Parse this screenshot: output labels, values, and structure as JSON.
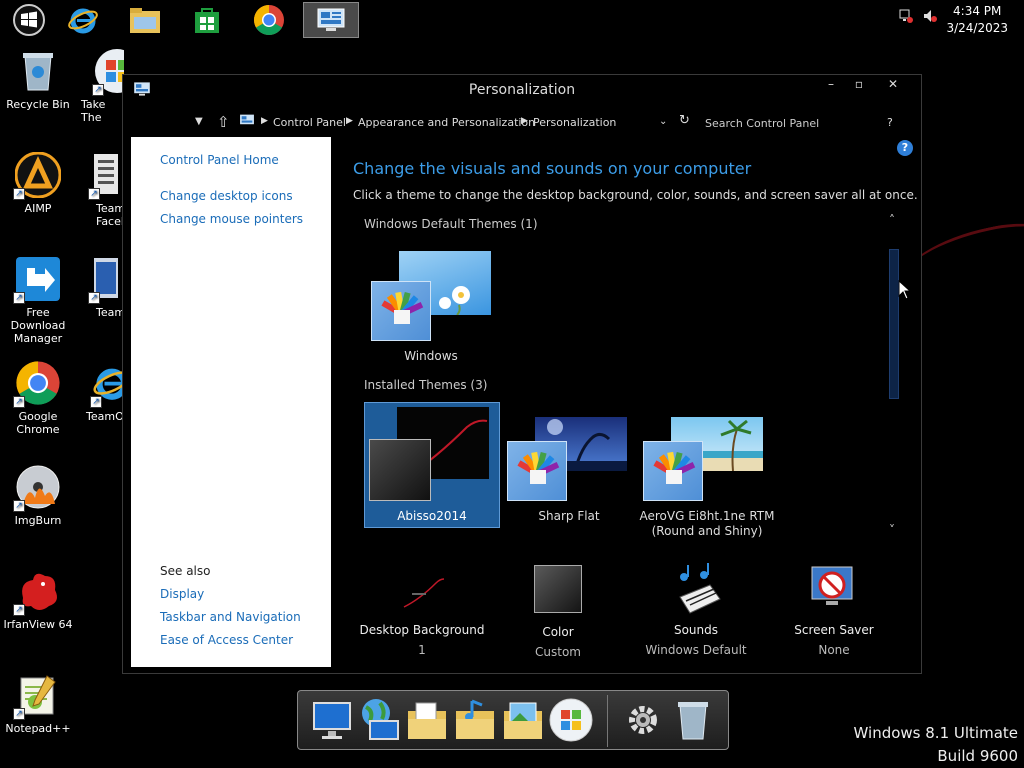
{
  "taskbar": {
    "clock_time": "4:34 PM",
    "clock_date": "3/24/2023"
  },
  "desktop_icons": [
    {
      "label": "Recycle Bin"
    },
    {
      "label": "Take The"
    },
    {
      "label": "AIMP"
    },
    {
      "label": "Team",
      "label2": "Faceboo"
    },
    {
      "label": "Free Download",
      "label2": "Manager"
    },
    {
      "label": "Team"
    },
    {
      "label": "Google Chrome"
    },
    {
      "label": "TeamOS"
    },
    {
      "label": "ImgBurn"
    },
    {
      "label": "IrfanView 64"
    },
    {
      "label": "Notepad++"
    }
  ],
  "window": {
    "title": "Personalization",
    "minimize": "–",
    "maximize": "▫",
    "close": "✕",
    "breadcrumbs": [
      "Control Panel",
      "Appearance and Personalization",
      "Personalization"
    ],
    "search_placeholder": "Search Control Panel",
    "help": "?",
    "left_pane": {
      "home": "Control Panel Home",
      "links": [
        "Change desktop icons",
        "Change mouse pointers"
      ],
      "see_also_label": "See also",
      "see_also": [
        "Display",
        "Taskbar and Navigation",
        "Ease of Access Center"
      ]
    },
    "main": {
      "heading": "Change the visuals and sounds on your computer",
      "subtitle": "Click a theme to change the desktop background, color, sounds, and screen saver all at once.",
      "default_group": "Windows Default Themes (1)",
      "installed_group": "Installed Themes (3)",
      "themes": [
        {
          "name": "Windows"
        },
        {
          "name": "Abisso2014"
        },
        {
          "name": "Sharp Flat"
        },
        {
          "name": "AeroVG Ei8ht.1ne RTM",
          "name2": "(Round and Shiny)"
        }
      ]
    },
    "bottom": [
      {
        "title": "Desktop Background",
        "value": "1"
      },
      {
        "title": "Color",
        "value": "Custom"
      },
      {
        "title": "Sounds",
        "value": "Windows Default"
      },
      {
        "title": "Screen Saver",
        "value": "None"
      }
    ]
  },
  "watermark": {
    "line1": "Windows 8.1 Ultimate",
    "line2": "Build 9600"
  },
  "colors": {
    "link": "#1a6cb8",
    "heading": "#3c9de8",
    "selected_theme": "#1e5c99"
  }
}
